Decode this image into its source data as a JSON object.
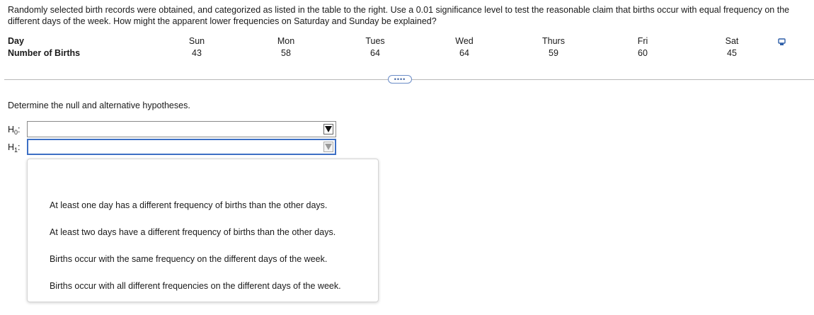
{
  "question": "Randomly selected birth records were obtained, and categorized as listed in the table to the right. Use a 0.01 significance level to test the reasonable claim that births occur with equal frequency on the different days of the week. How might the apparent lower frequencies on Saturday and Sunday be explained?",
  "table": {
    "row1_label": "Day",
    "row2_label": "Number of Births",
    "days": [
      "Sun",
      "Mon",
      "Tues",
      "Wed",
      "Thurs",
      "Fri",
      "Sat"
    ],
    "births": [
      "43",
      "58",
      "64",
      "64",
      "59",
      "60",
      "45"
    ]
  },
  "more_button": "••••",
  "prompt": "Determine the null and alternative hypotheses.",
  "h0": {
    "label": "H",
    "sub": "0",
    "suffix": ":",
    "value": ""
  },
  "h1": {
    "label": "H",
    "sub": "1",
    "suffix": ":",
    "value": ""
  },
  "dropdown_options": [
    "At least one day has a different frequency of births than the other days.",
    "At least two days have a different frequency of births than the other days.",
    "Births occur with the same frequency on the different days of the week.",
    "Births occur with all different frequencies on the different days of the week."
  ],
  "icons": {
    "copy": "copy-icon",
    "dropdown_arrow": "triangle-down-icon"
  },
  "colors": {
    "accent": "#3d6fc4",
    "divider": "#b8b8b8"
  }
}
